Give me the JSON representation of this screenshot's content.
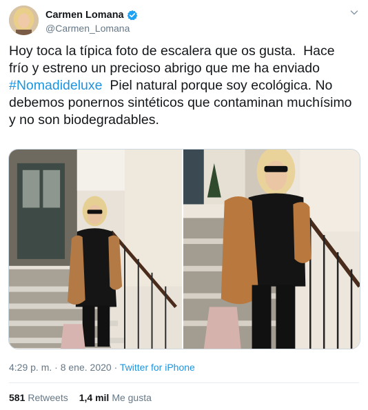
{
  "user": {
    "display_name": "Carmen Lomana",
    "handle": "@Carmen_Lomana",
    "verified": true
  },
  "tweet": {
    "text_before": "Hoy toca la típica foto de escalera que os gusta.  Hace frío y estreno un precioso abrigo que me ha enviado ",
    "hashtag": "#Nomadideluxe",
    "text_after": "  Piel natural porque soy ecológica. No debemos ponernos sintéticos que contaminan muchísimo y no son biodegradables."
  },
  "meta": {
    "time": "4:29 p. m.",
    "separator1": " · ",
    "date": "8 ene. 2020",
    "separator2": " · ",
    "source": "Twitter for iPhone"
  },
  "stats": {
    "retweets_count": "581",
    "retweets_label": "Retweets",
    "likes_count": "1,4 mil",
    "likes_label": "Me gusta"
  },
  "colors": {
    "link": "#1b95e0",
    "verified": "#1da1f2",
    "secondary_text": "#657786"
  },
  "icons": {
    "verified": "verified-badge-icon",
    "menu": "chevron-down-icon"
  }
}
